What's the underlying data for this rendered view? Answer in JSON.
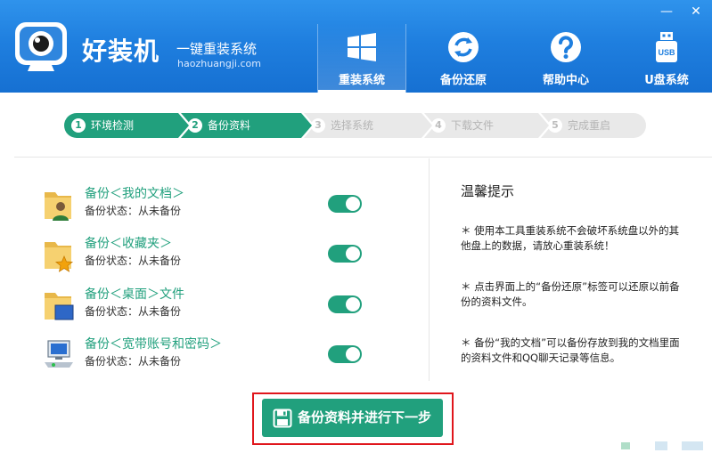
{
  "header": {
    "brand_name": "好装机",
    "slogan": "一键重装系统",
    "url": "haozhuangji.com",
    "window_controls": {
      "minimize": "—",
      "close": "✕"
    },
    "tabs": [
      {
        "label": "重装系统",
        "icon": "windows-logo-icon",
        "active": true
      },
      {
        "label": "备份还原",
        "icon": "refresh-icon",
        "active": false
      },
      {
        "label": "帮助中心",
        "icon": "question-icon",
        "active": false
      },
      {
        "label": "U盘系统",
        "icon": "usb-icon",
        "active": false
      }
    ]
  },
  "steps": [
    {
      "num": "1",
      "label": "环境检测",
      "state": "done"
    },
    {
      "num": "2",
      "label": "备份资料",
      "state": "current"
    },
    {
      "num": "3",
      "label": "选择系统",
      "state": "todo"
    },
    {
      "num": "4",
      "label": "下载文件",
      "state": "todo"
    },
    {
      "num": "5",
      "label": "完成重启",
      "state": "todo"
    }
  ],
  "backup_items": [
    {
      "title": "备份＜我的文档＞",
      "status": "备份状态：从未备份",
      "icon": "user-folder-icon",
      "enabled": true
    },
    {
      "title": "备份＜收藏夹＞",
      "status": "备份状态：从未备份",
      "icon": "favorites-folder-icon",
      "enabled": true
    },
    {
      "title": "备份＜桌面＞文件",
      "status": "备份状态：从未备份",
      "icon": "desktop-folder-icon",
      "enabled": true
    },
    {
      "title": "备份＜宽带账号和密码＞",
      "status": "备份状态：从未备份",
      "icon": "network-icon",
      "enabled": true
    }
  ],
  "tips": {
    "title": "温馨提示",
    "items": [
      "＊ 使用本工具重装系统不会破坏系统盘以外的其他盘上的数据，请放心重装系统！",
      "＊ 点击界面上的“备份还原”标签可以还原以前备份的资料文件。",
      "＊ 备份“我的文档”可以备份存放到我的文档里面的资料文件和QQ聊天记录等信息。"
    ]
  },
  "cta": {
    "label": "备份资料并进行下一步",
    "icon": "floppy-disk-icon"
  },
  "colors": {
    "header_blue": "#1f7fdf",
    "accent_green": "#21a07d",
    "highlight_red": "#e0161c"
  }
}
